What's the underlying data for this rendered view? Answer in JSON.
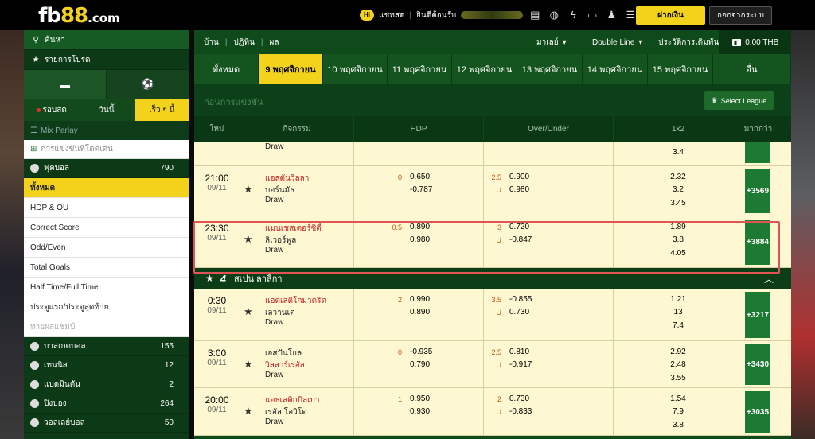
{
  "header": {
    "logo_main": "fb",
    "logo_num": "88",
    "logo_tld": ".com",
    "chat_badge": "Hi",
    "chat_label": "แชทสด",
    "welcome_label": "ยินดีต้อนรับ",
    "deposit_label": "ฝากเงิน",
    "logout_label": "ออกจากระบบ"
  },
  "sidebar": {
    "search_label": "ค้นหา",
    "favorites_label": "รายการโปรด",
    "tabs": [
      {
        "label": "รอบสด"
      },
      {
        "label": "วันนี้"
      },
      {
        "label": "เร็ว ๆ นี้"
      }
    ],
    "mix_parlay": "Mix Parlay",
    "outright": "การแข่งขันที่โดดเด่น",
    "football": {
      "label": "ฟุตบอล",
      "count": "790"
    },
    "bet_types": [
      "ทั้งหมด",
      "HDP & OU",
      "Correct Score",
      "Odd/Even",
      "Total Goals",
      "Half Time/Full Time",
      "ประตูแรก/ประตูสุดท้าย",
      "ทายผลแชมป์"
    ],
    "sports": [
      {
        "label": "บาสเกตบอล",
        "count": "155"
      },
      {
        "label": "เทนนิส",
        "count": "12"
      },
      {
        "label": "แบดมินตัน",
        "count": "2"
      },
      {
        "label": "ปิงปอง",
        "count": "264"
      },
      {
        "label": "วอลเลย์บอล",
        "count": "50"
      }
    ]
  },
  "topnav": {
    "crumbs": [
      "บ้าน",
      "ปฏิทิน",
      "ผล"
    ],
    "odds_type": "มาเลย์",
    "line_type": "Double Line",
    "history": "ประวัติการเดิมพัน",
    "balance": "0.00 THB"
  },
  "date_tabs": [
    "ทั้งหมด",
    "9 พฤศจิกายน",
    "10 พฤศจิกายน",
    "11 พฤศจิกายน",
    "12 พฤศจิกายน",
    "13 พฤศจิกายน",
    "14 พฤศจิกายน",
    "15 พฤศจิกายน",
    "อื่น"
  ],
  "section_title": "ก่อนการแข่งขัน",
  "select_league": "Select League",
  "columns": {
    "time": "ใหม่",
    "event": "กิจกรรม",
    "hdp": "HDP",
    "ou": "Over/Under",
    "x12": "1x2",
    "more": "มากกว่า"
  },
  "partial": {
    "draw": "Draw",
    "x12_3": "3.4"
  },
  "matches_epl": [
    {
      "time": "21:00",
      "date": "09/11",
      "home": "แอสตันวิลลา",
      "away": "บอร์นมัธ",
      "draw": "Draw",
      "hdp_line": "0",
      "hdp_home": "0.650",
      "hdp_away": "-0.787",
      "ou_line": "2.5",
      "ou_over": "0.900",
      "ou_u": "U",
      "ou_under": "0.980",
      "x1": "2.32",
      "x2": "3.2",
      "x3": "3.45",
      "more": "+3569"
    },
    {
      "time": "23:30",
      "date": "09/11",
      "home": "แมนเชสเตอร์ซิตี้",
      "away": "ลิเวอร์พูล",
      "draw": "Draw",
      "hdp_line": "0.5",
      "hdp_home": "0.890",
      "hdp_away": "0.980",
      "ou_line": "3",
      "ou_over": "0.720",
      "ou_u": "U",
      "ou_under": "-0.847",
      "x1": "1.89",
      "x2": "3.8",
      "x3": "4.05",
      "more": "+3884"
    }
  ],
  "league2": "สเปน ลาลีกา",
  "matches_laliga": [
    {
      "time": "0:30",
      "date": "09/11",
      "home": "แอตเลติโกมาดริด",
      "away": "เลวานเต",
      "draw": "Draw",
      "hdp_line": "2",
      "hdp_home": "0.990",
      "hdp_away": "0.890",
      "ou_line": "3.5",
      "ou_over": "-0.855",
      "ou_u": "U",
      "ou_under": "0.730",
      "x1": "1.21",
      "x2": "13",
      "x3": "7.4",
      "more": "+3217"
    },
    {
      "time": "3:00",
      "date": "09/11",
      "home": "เอสปันโยล",
      "away": "วิลลาร์เรอัล",
      "draw": "Draw",
      "hdp_line": "0",
      "hdp_home": "-0.935",
      "hdp_away": "0.790",
      "ou_line": "2.5",
      "ou_over": "0.810",
      "ou_u": "U",
      "ou_under": "-0.917",
      "x1": "2.92",
      "x2": "2.48",
      "x3": "3.55",
      "more": "+3430"
    },
    {
      "time": "20:00",
      "date": "09/11",
      "home": "แอธเลติกบิลเบา",
      "away": "เรอัล โอวิโด",
      "draw": "Draw",
      "hdp_line": "1",
      "hdp_home": "0.950",
      "hdp_away": "0.930",
      "ou_line": "2",
      "ou_over": "0.730",
      "ou_u": "U",
      "ou_under": "-0.833",
      "x1": "1.54",
      "x2": "7.9",
      "x3": "3.8",
      "more": "+3035"
    }
  ]
}
